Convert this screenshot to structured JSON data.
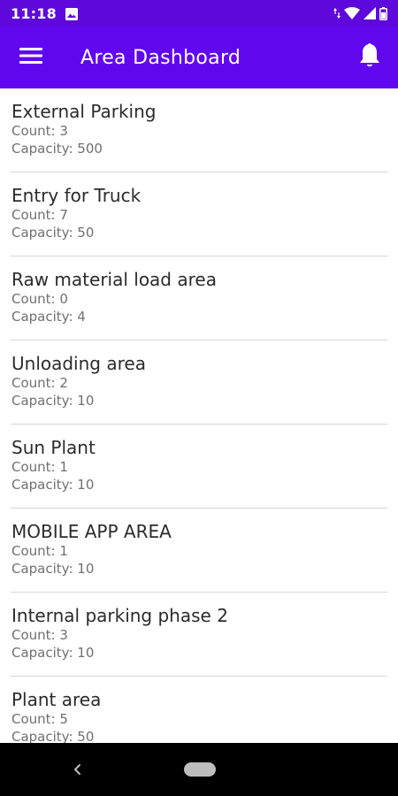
{
  "status_bar": {
    "time": "11:18",
    "left_icons": [
      "image-icon"
    ],
    "right_icons": [
      "wifi-icon",
      "signal-icon",
      "battery-icon"
    ]
  },
  "app_bar": {
    "title": "Area Dashboard",
    "menu_icon": "hamburger-menu-icon",
    "notification_icon": "bell-icon"
  },
  "areas": [
    {
      "name": "External Parking",
      "count": "Count: 3",
      "capacity": "Capacity: 500"
    },
    {
      "name": "Entry for Truck",
      "count": "Count: 7",
      "capacity": "Capacity: 50"
    },
    {
      "name": "Raw material load area",
      "count": "Count: 0",
      "capacity": "Capacity: 4"
    },
    {
      "name": "Unloading area",
      "count": "Count: 2",
      "capacity": "Capacity: 10"
    },
    {
      "name": "Sun Plant",
      "count": "Count: 1",
      "capacity": "Capacity: 10"
    },
    {
      "name": "MOBILE APP AREA",
      "count": "Count: 1",
      "capacity": "Capacity: 10"
    },
    {
      "name": "Internal parking phase 2",
      "count": "Count: 3",
      "capacity": "Capacity: 10"
    },
    {
      "name": "Plant area",
      "count": "Count: 5",
      "capacity": "Capacity: 50"
    }
  ],
  "nav_bar": {
    "icons": [
      "back-icon",
      "home-pill-icon"
    ]
  },
  "colors": {
    "status_bar": "#5e08db",
    "app_bar": "#6107f0",
    "divider": "#d6d6d6",
    "primary_text": "#2b2b2b",
    "secondary_text": "#707070",
    "nav_bar": "#000000"
  }
}
